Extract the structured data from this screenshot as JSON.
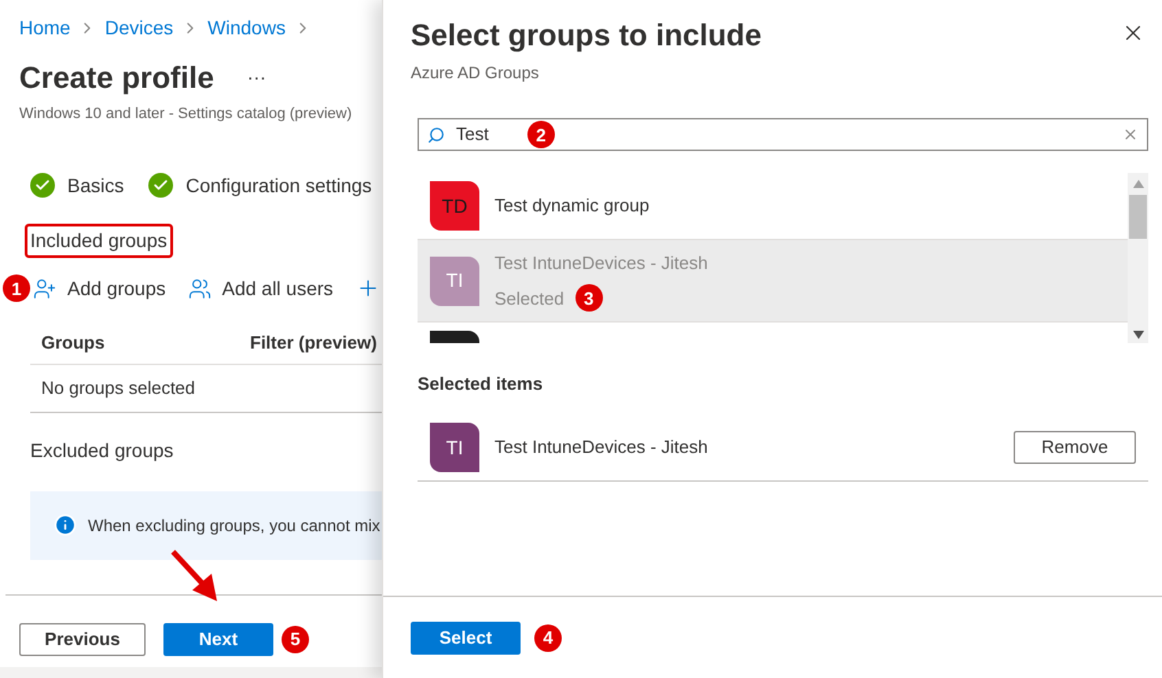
{
  "breadcrumb": [
    {
      "label": "Home"
    },
    {
      "label": "Devices"
    },
    {
      "label": "Windows"
    }
  ],
  "page": {
    "title": "Create profile",
    "more": "···",
    "subtitle": "Windows 10 and later - Settings catalog (preview)"
  },
  "steps": [
    {
      "label": "Basics",
      "done": true
    },
    {
      "label": "Configuration settings",
      "done": true
    }
  ],
  "included": {
    "heading": "Included groups",
    "callout": true
  },
  "toolbar": [
    {
      "kind": "add-groups",
      "label": "Add groups",
      "marker": "1"
    },
    {
      "kind": "add-users",
      "label": "Add all users"
    },
    {
      "kind": "add"
    }
  ],
  "table": {
    "columns": [
      "Groups",
      "Filter (preview)"
    ],
    "empty": "No groups selected"
  },
  "excluded": {
    "heading": "Excluded groups",
    "info": "When excluding groups, you cannot mix"
  },
  "footer": [
    {
      "label": "Previous",
      "primary": false
    },
    {
      "label": "Next",
      "primary": true,
      "marker": "5",
      "arrow": true
    }
  ],
  "panel": {
    "title": "Select groups to include",
    "subtitle": "Azure AD Groups",
    "search": {
      "value": "Test",
      "marker": "2"
    },
    "results": [
      {
        "initials": "TD",
        "name": "Test dynamic group",
        "color": "#e81123",
        "selected": false
      },
      {
        "initials": "TI",
        "name": "Test IntuneDevices - Jitesh",
        "color": "#b591b0",
        "selected": true,
        "status": "Selected",
        "marker": "3"
      },
      {
        "color": "#1f1f1f",
        "selected": false
      }
    ],
    "selected_heading": "Selected items",
    "selected_items": [
      {
        "initials": "TI",
        "name": "Test IntuneDevices - Jitesh",
        "color": "#7a3b73",
        "action": "Remove"
      }
    ],
    "primary_button": {
      "label": "Select",
      "marker": "4"
    }
  }
}
